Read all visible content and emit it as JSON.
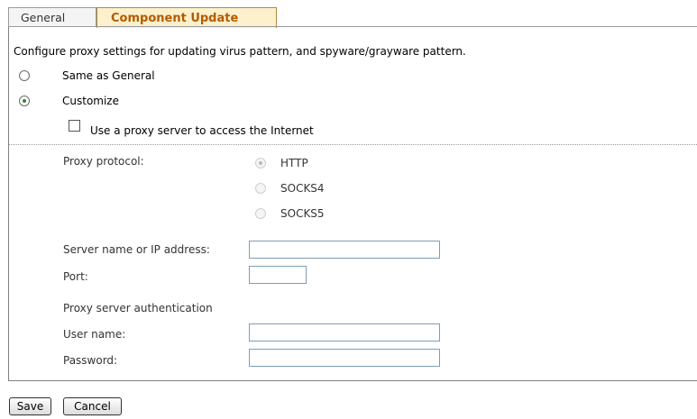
{
  "tabs": {
    "general": "General",
    "component_update": "Component Update"
  },
  "description": "Configure proxy settings for updating virus pattern, and spyware/grayware pattern.",
  "mode_options": {
    "same_as_general": "Same as General",
    "customize": "Customize",
    "selected": "customize"
  },
  "use_proxy_label": "Use a proxy server to access the Internet",
  "use_proxy_checked": false,
  "proxy_protocol": {
    "label": "Proxy protocol:",
    "options": [
      "HTTP",
      "SOCKS4",
      "SOCKS5"
    ],
    "selected": "HTTP"
  },
  "fields": {
    "server_label": "Server name or IP address:",
    "server_value": "",
    "port_label": "Port:",
    "port_value": "",
    "auth_heading": "Proxy server authentication",
    "username_label": "User name:",
    "username_value": "",
    "password_label": "Password:",
    "password_value": ""
  },
  "buttons": {
    "save": "Save",
    "cancel": "Cancel"
  }
}
